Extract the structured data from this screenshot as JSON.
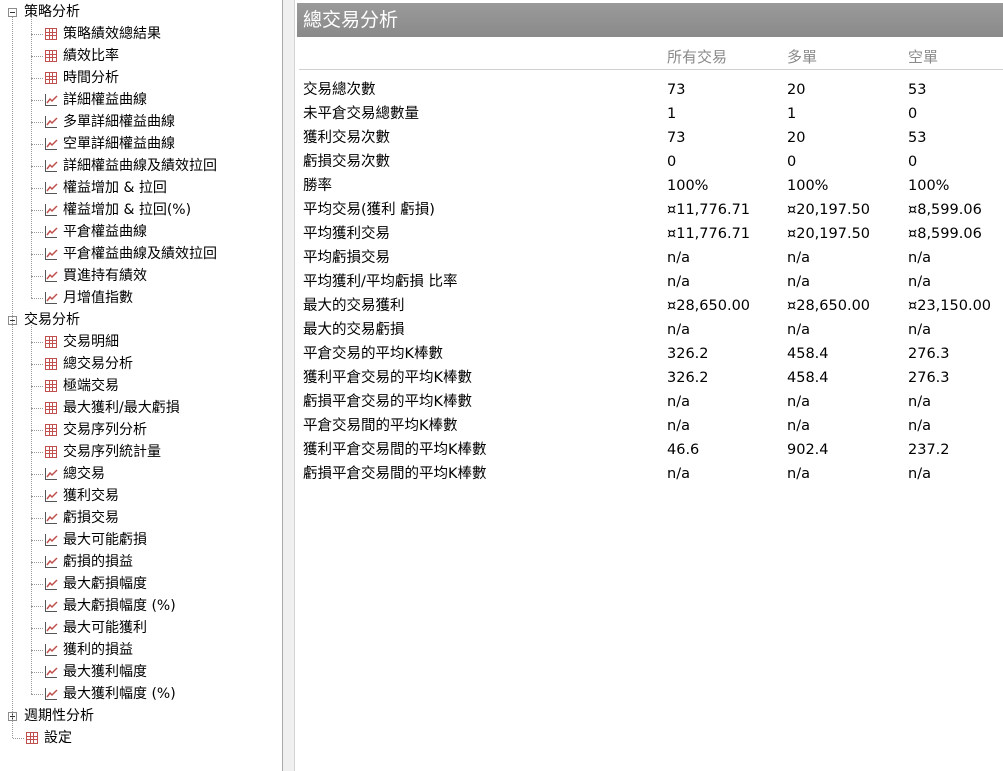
{
  "tree": {
    "groups": [
      {
        "label": "策略分析",
        "expanded": true,
        "items": [
          {
            "label": "策略績效總結果",
            "icon": "grid-icon"
          },
          {
            "label": "績效比率",
            "icon": "grid-icon"
          },
          {
            "label": "時間分析",
            "icon": "grid-icon"
          },
          {
            "label": "詳細權益曲線",
            "icon": "chart-icon"
          },
          {
            "label": "多單詳細權益曲線",
            "icon": "chart-icon"
          },
          {
            "label": "空單詳細權益曲線",
            "icon": "chart-icon"
          },
          {
            "label": "詳細權益曲線及績效拉回",
            "icon": "chart-icon"
          },
          {
            "label": "權益增加 & 拉回",
            "icon": "chart-icon"
          },
          {
            "label": "權益增加 & 拉回(%)",
            "icon": "chart-icon"
          },
          {
            "label": "平倉權益曲線",
            "icon": "chart-icon"
          },
          {
            "label": "平倉權益曲線及績效拉回",
            "icon": "chart-icon"
          },
          {
            "label": "買進持有績效",
            "icon": "chart-icon"
          },
          {
            "label": "月增值指數",
            "icon": "chart-icon"
          }
        ]
      },
      {
        "label": "交易分析",
        "expanded": true,
        "items": [
          {
            "label": "交易明細",
            "icon": "grid-icon"
          },
          {
            "label": "總交易分析",
            "icon": "grid-icon"
          },
          {
            "label": "極端交易",
            "icon": "grid-icon"
          },
          {
            "label": "最大獲利/最大虧損",
            "icon": "grid-icon"
          },
          {
            "label": "交易序列分析",
            "icon": "grid-icon"
          },
          {
            "label": "交易序列統計量",
            "icon": "grid-icon"
          },
          {
            "label": "總交易",
            "icon": "chart-icon"
          },
          {
            "label": "獲利交易",
            "icon": "chart-icon"
          },
          {
            "label": "虧損交易",
            "icon": "chart-icon"
          },
          {
            "label": "最大可能虧損",
            "icon": "chart-icon"
          },
          {
            "label": "虧損的損益",
            "icon": "chart-icon"
          },
          {
            "label": "最大虧損幅度",
            "icon": "chart-icon"
          },
          {
            "label": "最大虧損幅度 (%)",
            "icon": "chart-icon"
          },
          {
            "label": "最大可能獲利",
            "icon": "chart-icon"
          },
          {
            "label": "獲利的損益",
            "icon": "chart-icon"
          },
          {
            "label": "最大獲利幅度",
            "icon": "chart-icon"
          },
          {
            "label": "最大獲利幅度 (%)",
            "icon": "chart-icon"
          }
        ]
      },
      {
        "label": "週期性分析",
        "expanded": false,
        "items": []
      }
    ],
    "footer_item": {
      "label": "設定",
      "icon": "grid-icon"
    }
  },
  "content": {
    "title": "總交易分析",
    "columns": [
      "所有交易",
      "多單",
      "空單"
    ],
    "rows": [
      {
        "label": "交易總次數",
        "values": [
          "73",
          "20",
          "53"
        ]
      },
      {
        "label": "未平倉交易總數量",
        "values": [
          "1",
          "1",
          "0"
        ]
      },
      {
        "label": "獲利交易次數",
        "values": [
          "73",
          "20",
          "53"
        ]
      },
      {
        "label": "虧損交易次數",
        "values": [
          "0",
          "0",
          "0"
        ]
      },
      {
        "label": "勝率",
        "values": [
          "100%",
          "100%",
          "100%"
        ]
      },
      {
        "label": "平均交易(獲利 虧損)",
        "values": [
          "¤11,776.71",
          "¤20,197.50",
          "¤8,599.06"
        ]
      },
      {
        "label": "平均獲利交易",
        "values": [
          "¤11,776.71",
          "¤20,197.50",
          "¤8,599.06"
        ]
      },
      {
        "label": "平均虧損交易",
        "values": [
          "n/a",
          "n/a",
          "n/a"
        ]
      },
      {
        "label": "平均獲利/平均虧損 比率",
        "values": [
          "n/a",
          "n/a",
          "n/a"
        ]
      },
      {
        "label": "最大的交易獲利",
        "values": [
          "¤28,650.00",
          "¤28,650.00",
          "¤23,150.00"
        ]
      },
      {
        "label": "最大的交易虧損",
        "values": [
          "n/a",
          "n/a",
          "n/a"
        ]
      },
      {
        "label": "平倉交易的平均K棒數",
        "values": [
          "326.2",
          "458.4",
          "276.3"
        ]
      },
      {
        "label": "獲利平倉交易的平均K棒數",
        "values": [
          "326.2",
          "458.4",
          "276.3"
        ]
      },
      {
        "label": "虧損平倉交易的平均K棒數",
        "values": [
          "n/a",
          "n/a",
          "n/a"
        ]
      },
      {
        "label": "平倉交易間的平均K棒數",
        "values": [
          "n/a",
          "n/a",
          "n/a"
        ]
      },
      {
        "label": "獲利平倉交易間的平均K棒數",
        "values": [
          "46.6",
          "902.4",
          "237.2"
        ]
      },
      {
        "label": "虧損平倉交易間的平均K棒數",
        "values": [
          "n/a",
          "n/a",
          "n/a"
        ]
      }
    ]
  },
  "colors": {
    "header_bg": "#8f8f8f",
    "grid_icon": "#c0504d",
    "chart_icon_line": "#c0504d",
    "column_header_text": "#8a8a8a"
  }
}
